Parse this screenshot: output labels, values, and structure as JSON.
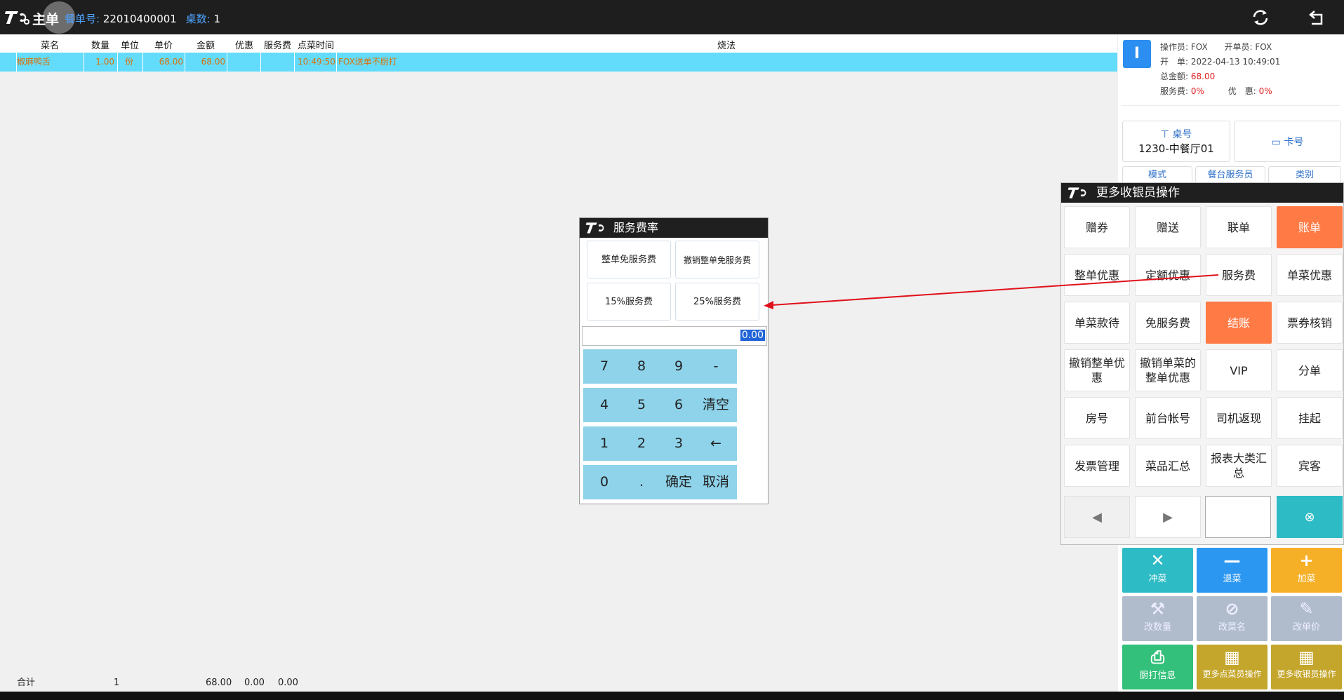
{
  "header": {
    "title": "主单",
    "order_no_label": "餐单号:",
    "order_no": "22010400001",
    "tables_label": "桌数:",
    "tables": "1"
  },
  "columns": [
    "菜名",
    "数量",
    "单位",
    "单价",
    "金额",
    "优惠",
    "服务费",
    "点菜时间",
    "烧法"
  ],
  "items": [
    {
      "name": "椒麻鸭舌",
      "qty": "1.00",
      "unit": "份",
      "price": "68.00",
      "amount": "68.00",
      "discount": "",
      "service": "",
      "time": "10:49:50",
      "note": "FOX送单不厨打"
    }
  ],
  "totals": {
    "label": "合计",
    "qty": "1",
    "amount": "68.00",
    "discount": "0.00",
    "service": "0.00"
  },
  "order_panel": {
    "badge": "I",
    "operator_label": "操作员:",
    "operator": "FOX",
    "opener_label": "开单员:",
    "opener": "FOX",
    "open_label": "开　单:",
    "open_time": "2022-04-13 10:49:01",
    "total_label": "总金额:",
    "total": "68.00",
    "service_label": "服务费:",
    "service": "0%",
    "discount_label": "优　惠:",
    "discount": "0%",
    "table_label": "桌号",
    "table_value": "1230-中餐厅01",
    "card_label": "卡号",
    "mode_label": "模式",
    "waiter_label": "餐台服务员",
    "category_label": "类别"
  },
  "actions": [
    {
      "label": "冲菜",
      "icon": "✕"
    },
    {
      "label": "退菜",
      "icon": "—"
    },
    {
      "label": "加菜",
      "icon": "+"
    },
    {
      "label": "改数量",
      "icon": "⚒"
    },
    {
      "label": "改菜名",
      "icon": "⊘"
    },
    {
      "label": "改单价",
      "icon": "✎"
    },
    {
      "label": "厨打信息",
      "icon": "⎙"
    },
    {
      "label": "更多点菜员操作",
      "icon": "▦"
    },
    {
      "label": "更多收银员操作",
      "icon": "▦"
    }
  ],
  "service_dialog": {
    "title": "服务费率",
    "options": [
      "整单免服务费",
      "撤销整单免服务费",
      "15%服务费",
      "25%服务费"
    ],
    "input_value": "0.00",
    "keys": [
      "7",
      "8",
      "9",
      "-",
      "4",
      "5",
      "6",
      "清空",
      "1",
      "2",
      "3",
      "←",
      "0",
      ".",
      "确定",
      "取消"
    ]
  },
  "cashier_dialog": {
    "title": "更多收银员操作",
    "buttons": [
      "赠券",
      "赠送",
      "联单",
      "账单",
      "整单优惠",
      "定额优惠",
      "服务费",
      "单菜优惠",
      "单菜款待",
      "免服务费",
      "结账",
      "票券核销",
      "撤销整单优惠",
      "撤销单菜的整单优惠",
      "VIP",
      "分单",
      "房号",
      "前台帐号",
      "司机返现",
      "挂起",
      "发票管理",
      "菜品汇总",
      "报表大类汇总",
      "宾客"
    ],
    "nav_prev": "◀",
    "nav_next": "▶",
    "clear_icon": "⊗"
  },
  "colors": {
    "accent": "#2c8ef0",
    "highlight": "#ff7a45",
    "row": "#63dcfc",
    "keypad": "#8ed3ea"
  }
}
